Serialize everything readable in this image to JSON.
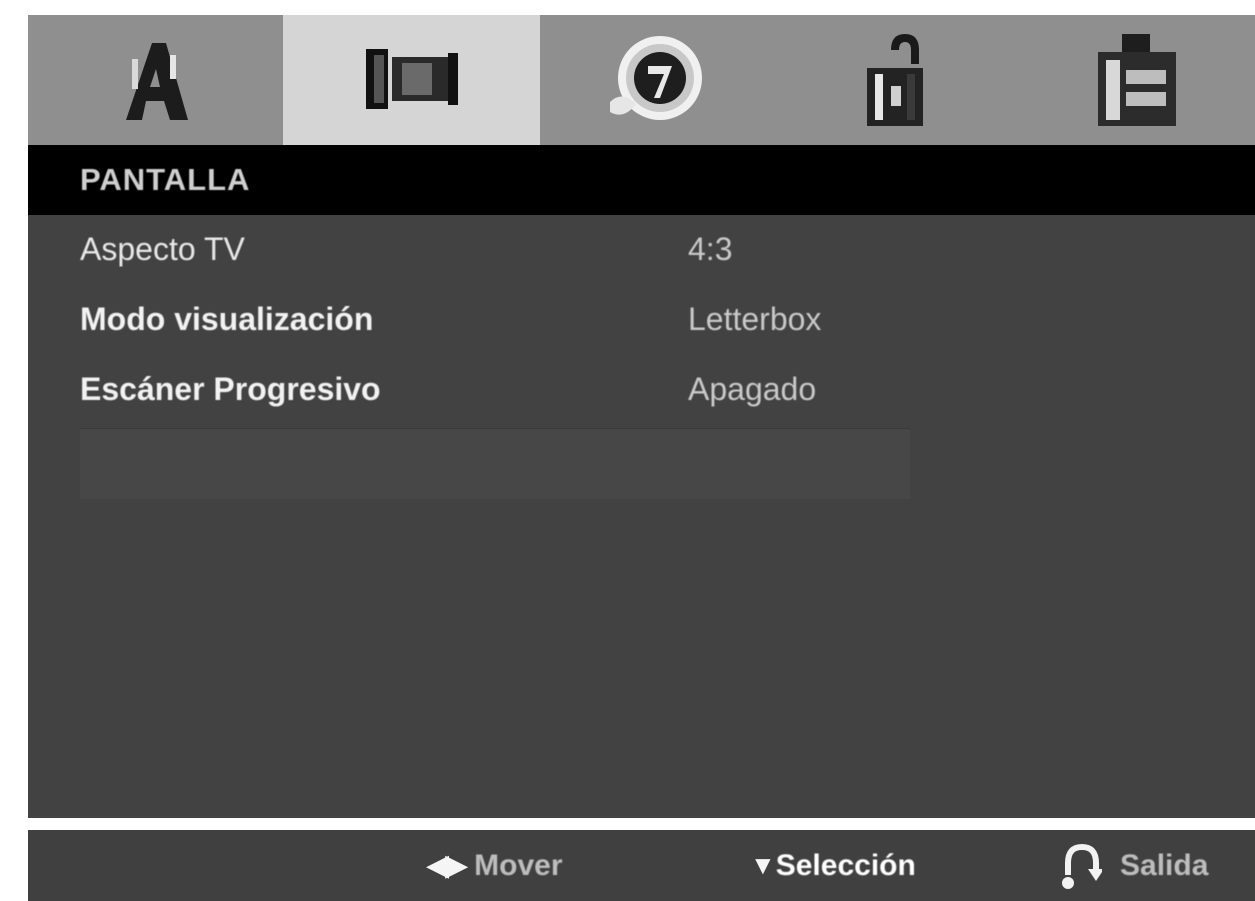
{
  "tabs": [
    {
      "icon": "language-icon",
      "selected": false
    },
    {
      "icon": "display-icon",
      "selected": true
    },
    {
      "icon": "audio-icon",
      "selected": false
    },
    {
      "icon": "lock-icon",
      "selected": false
    },
    {
      "icon": "others-icon",
      "selected": false
    }
  ],
  "section": {
    "title": "PANTALLA"
  },
  "menu": {
    "items": [
      {
        "label": "Aspecto TV",
        "value": "4:3"
      },
      {
        "label": "Modo visualización",
        "value": "Letterbox"
      },
      {
        "label": "Escáner Progresivo",
        "value": "Apagado"
      }
    ]
  },
  "footer": {
    "move_icon": "◀▶",
    "move_label": "Mover",
    "select_icon": "▼",
    "select_label": "Selección",
    "exit_icon": "return-icon",
    "exit_label": "Salida"
  },
  "colors": {
    "tab_bar": "#8f8f8f",
    "tab_selected": "#d5d5d5",
    "header": "#000000",
    "panel": "#424242",
    "footer": "#404040"
  }
}
